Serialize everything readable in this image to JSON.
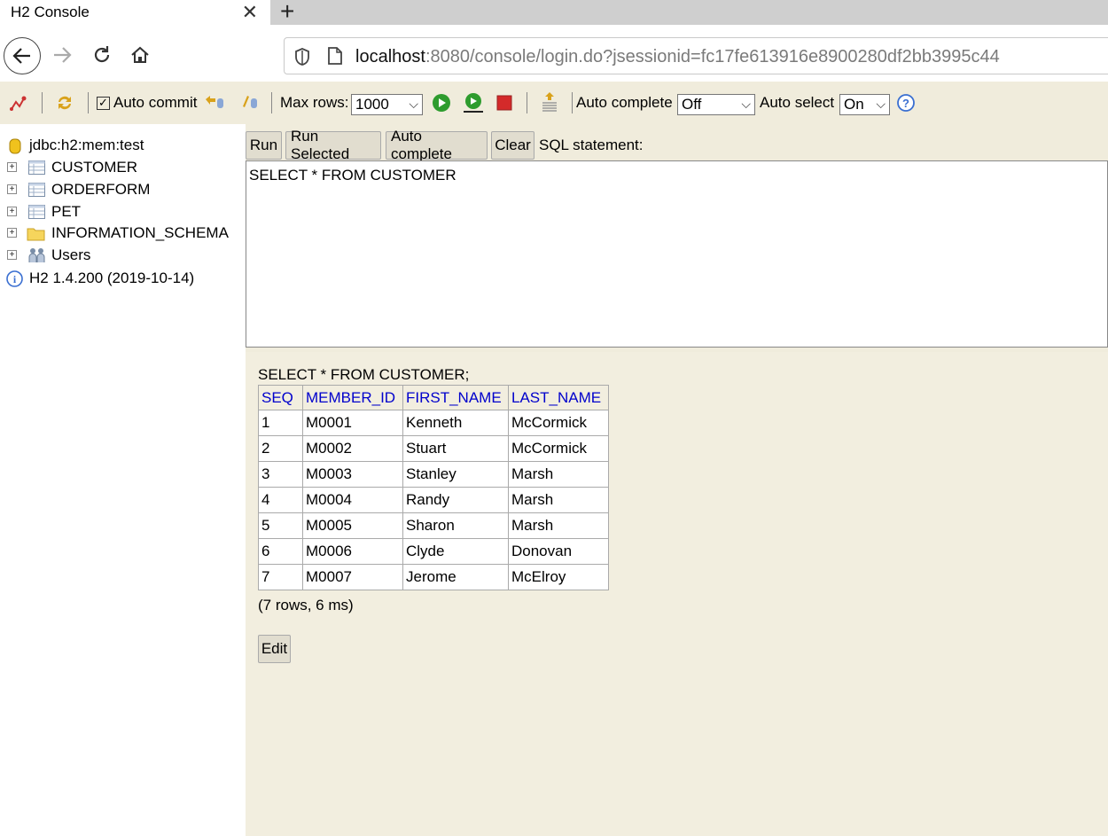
{
  "browser": {
    "tab_title": "H2 Console",
    "url_host": "localhost",
    "url_rest": ":8080/console/login.do?jsessionid=fc17fe613916e8900280df2bb3995c44"
  },
  "toolbar": {
    "auto_commit_label": "Auto commit",
    "auto_commit_checked": true,
    "max_rows_label": "Max rows:",
    "max_rows_value": "1000",
    "auto_complete_label": "Auto complete",
    "auto_complete_value": "Off",
    "auto_select_label": "Auto select",
    "auto_select_value": "On"
  },
  "tree": {
    "connection": "jdbc:h2:mem:test",
    "items": [
      {
        "label": "CUSTOMER",
        "icon": "table-icon"
      },
      {
        "label": "ORDERFORM",
        "icon": "table-icon"
      },
      {
        "label": "PET",
        "icon": "table-icon"
      },
      {
        "label": "INFORMATION_SCHEMA",
        "icon": "folder-icon"
      },
      {
        "label": "Users",
        "icon": "users-icon"
      }
    ],
    "version": "H2 1.4.200 (2019-10-14)"
  },
  "query": {
    "run_label": "Run",
    "run_selected_label": "Run Selected",
    "auto_complete_label": "Auto complete",
    "clear_label": "Clear",
    "sql_statement_label": "SQL statement:",
    "sql_text": "SELECT * FROM CUSTOMER"
  },
  "results": {
    "title": "SELECT * FROM CUSTOMER;",
    "columns": [
      "SEQ",
      "MEMBER_ID",
      "FIRST_NAME",
      "LAST_NAME"
    ],
    "rows": [
      [
        "1",
        "M0001",
        "Kenneth",
        "McCormick"
      ],
      [
        "2",
        "M0002",
        "Stuart",
        "McCormick"
      ],
      [
        "3",
        "M0003",
        "Stanley",
        "Marsh"
      ],
      [
        "4",
        "M0004",
        "Randy",
        "Marsh"
      ],
      [
        "5",
        "M0005",
        "Sharon",
        "Marsh"
      ],
      [
        "6",
        "M0006",
        "Clyde",
        "Donovan"
      ],
      [
        "7",
        "M0007",
        "Jerome",
        "McElroy"
      ]
    ],
    "status": "(7 rows, 6 ms)",
    "edit_label": "Edit"
  }
}
